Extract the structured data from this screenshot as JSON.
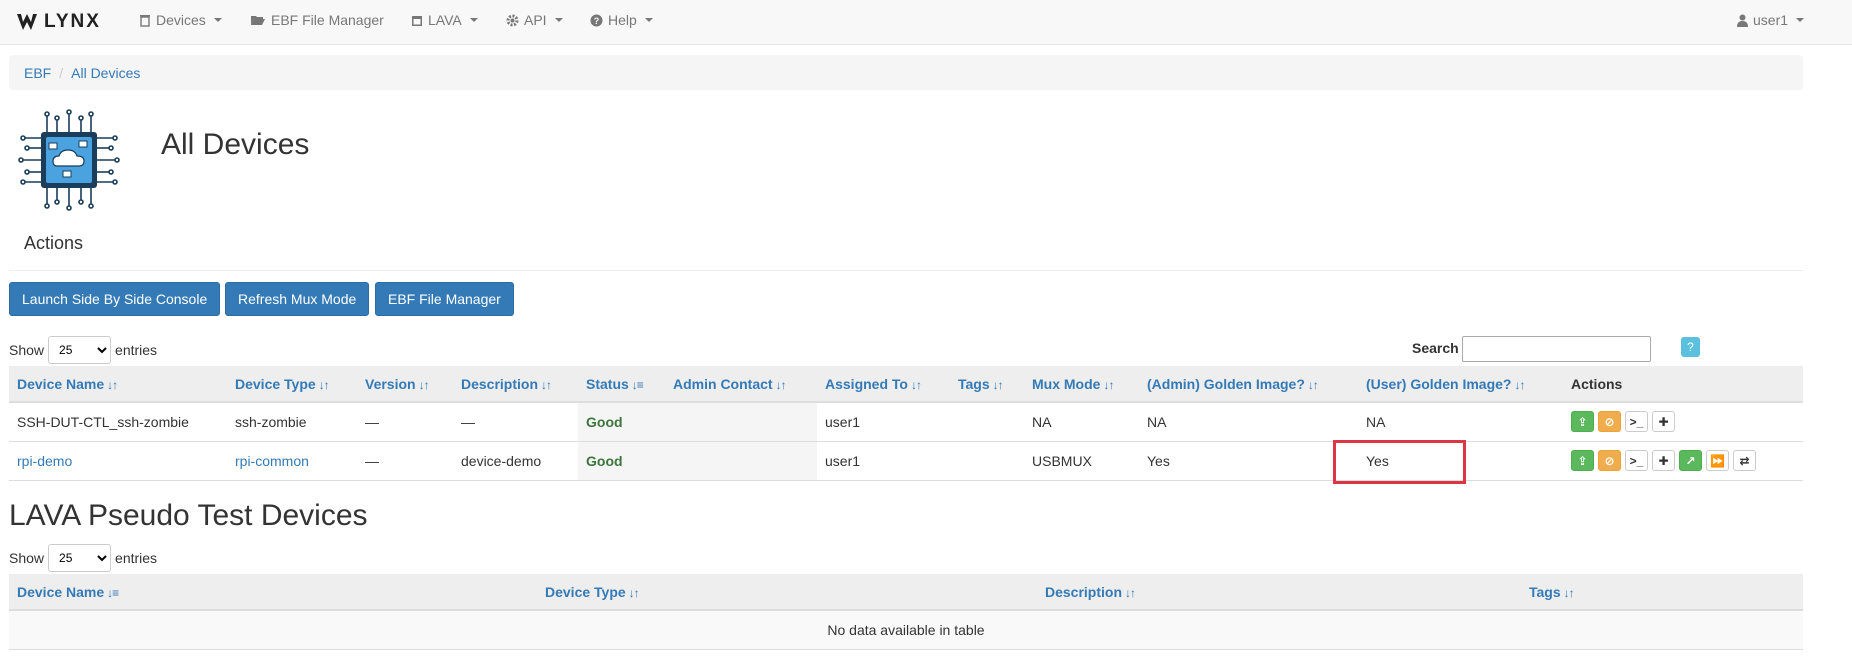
{
  "navbar": {
    "brand": "LYNX",
    "items": [
      {
        "label": "Devices",
        "icon": "trash-icon"
      },
      {
        "label": "EBF File Manager",
        "icon": "folder-open-icon"
      },
      {
        "label": "LAVA",
        "icon": "calendar-icon"
      },
      {
        "label": "API",
        "icon": "gear-icon"
      },
      {
        "label": "Help",
        "icon": "question-circle-icon"
      }
    ],
    "user": "user1"
  },
  "breadcrumb": [
    "EBF",
    "All Devices"
  ],
  "page": {
    "title": "All Devices",
    "actions_heading": "Actions",
    "buttons": [
      "Launch Side By Side Console",
      "Refresh Mux Mode",
      "EBF File Manager"
    ]
  },
  "devices_table": {
    "show_label": "Show",
    "entries_label": "entries",
    "page_size": "25",
    "search_label": "Search",
    "help_label": "?",
    "columns": [
      "Device Name",
      "Device Type",
      "Version",
      "Description",
      "Status",
      "Admin Contact",
      "Assigned To",
      "Tags",
      "Mux Mode",
      "(Admin) Golden Image?",
      "(User) Golden Image?",
      "Actions"
    ],
    "rows": [
      {
        "name": "SSH-DUT-CTL_ssh-zombie",
        "type": "ssh-zombie",
        "version": "—",
        "description": "—",
        "status": "Good",
        "admin_contact": "",
        "assigned_to": "user1",
        "tags": "",
        "mux_mode": "NA",
        "admin_golden": "NA",
        "user_golden": "NA"
      },
      {
        "name": "rpi-demo",
        "type": "rpi-common",
        "version": "—",
        "description": "device-demo",
        "status": "Good",
        "admin_contact": "",
        "assigned_to": "user1",
        "tags": "",
        "mux_mode": "USBMUX",
        "admin_golden": "Yes",
        "user_golden": "Yes"
      }
    ]
  },
  "lava_section": {
    "title": "LAVA Pseudo Test Devices",
    "show_label": "Show",
    "entries_label": "entries",
    "page_size": "25",
    "columns": [
      "Device Name",
      "Device Type",
      "Description",
      "Tags"
    ],
    "empty_message": "No data available in table"
  },
  "colors": {
    "primary": "#337ab7",
    "success": "#5cb85c",
    "warning": "#f0ad4e",
    "info": "#5bc0de",
    "status_good": "#3c763d",
    "highlight": "#dc3545"
  }
}
